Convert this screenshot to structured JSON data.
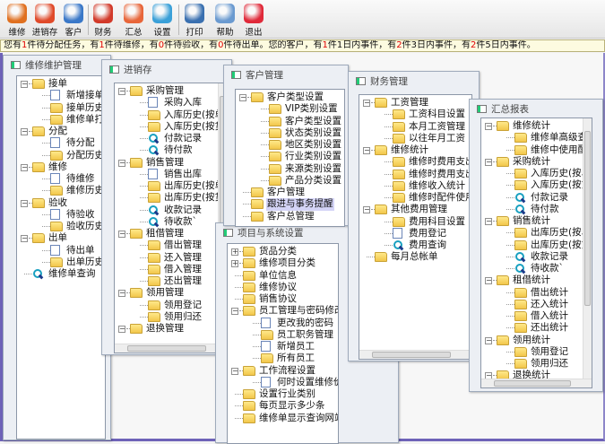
{
  "toolbar": {
    "buttons": [
      {
        "label": "维修",
        "icon": "wrench-icon",
        "color": "#e07020"
      },
      {
        "label": "进销存",
        "icon": "inventory-icon",
        "color": "#e04a2a"
      },
      {
        "label": "客户",
        "icon": "customers-icon",
        "color": "#3a78c8"
      },
      {
        "label": "财务",
        "icon": "finance-icon",
        "color": "#d23a2a"
      },
      {
        "label": "汇总",
        "icon": "summary-icon",
        "color": "#e8663a"
      },
      {
        "label": "设置",
        "icon": "settings-icon",
        "color": "#3aa0d8"
      },
      {
        "label": "打印",
        "icon": "printer-icon",
        "color": "#3a70b0"
      },
      {
        "label": "帮助",
        "icon": "help-icon",
        "color": "#6a9ad0"
      },
      {
        "label": "退出",
        "icon": "power-icon",
        "color": "#e02a3a"
      }
    ]
  },
  "status": {
    "segments": [
      {
        "text": "您有",
        "red": false
      },
      {
        "text": "1",
        "red": true
      },
      {
        "text": "件待分配任务，有",
        "red": false
      },
      {
        "text": "1",
        "red": true
      },
      {
        "text": "件待维修，有",
        "red": false
      },
      {
        "text": "0",
        "red": true
      },
      {
        "text": "件待验收，有",
        "red": false
      },
      {
        "text": "0",
        "red": true
      },
      {
        "text": "件待出单。您的客户，有",
        "red": false
      },
      {
        "text": "1",
        "red": true
      },
      {
        "text": "件1日内事件，有",
        "red": false
      },
      {
        "text": "2",
        "red": true
      },
      {
        "text": "件3日内事件，有",
        "red": false
      },
      {
        "text": "2",
        "red": true
      },
      {
        "text": "件5日内事件。",
        "red": false
      }
    ]
  },
  "windows": [
    {
      "id": "w1",
      "title": "维修维护管理",
      "items": [
        {
          "label": "接单",
          "level": 0,
          "icon": "folder",
          "exp": "-"
        },
        {
          "label": "新增接单登记",
          "level": 1,
          "icon": "page"
        },
        {
          "label": "接单历史",
          "level": 1,
          "icon": "folder"
        },
        {
          "label": "维修单打印设",
          "level": 1,
          "icon": "folder"
        },
        {
          "label": "分配",
          "level": 0,
          "icon": "folder",
          "exp": "-"
        },
        {
          "label": "待分配",
          "level": 1,
          "icon": "page"
        },
        {
          "label": "分配历史",
          "level": 1,
          "icon": "folder"
        },
        {
          "label": "维修",
          "level": 0,
          "icon": "folder",
          "exp": "-"
        },
        {
          "label": "待维修",
          "level": 1,
          "icon": "page"
        },
        {
          "label": "维修历史",
          "level": 1,
          "icon": "folder"
        },
        {
          "label": "验收",
          "level": 0,
          "icon": "folder",
          "exp": "-"
        },
        {
          "label": "待验收",
          "level": 1,
          "icon": "page"
        },
        {
          "label": "验收历史",
          "level": 1,
          "icon": "folder"
        },
        {
          "label": "出单",
          "level": 0,
          "icon": "folder",
          "exp": "-"
        },
        {
          "label": "待出单",
          "level": 1,
          "icon": "page"
        },
        {
          "label": "出单历史",
          "level": 1,
          "icon": "folder"
        },
        {
          "label": "维修单查询",
          "level": 0,
          "icon": "search"
        }
      ]
    },
    {
      "id": "w2",
      "title": "进销存",
      "items": [
        {
          "label": "采购管理",
          "level": 0,
          "icon": "folder",
          "exp": "-"
        },
        {
          "label": "采购入库",
          "level": 1,
          "icon": "page"
        },
        {
          "label": "入库历史(按单据",
          "level": 1,
          "icon": "folder"
        },
        {
          "label": "入库历史(按货品",
          "level": 1,
          "icon": "folder"
        },
        {
          "label": "付款记录",
          "level": 1,
          "icon": "search"
        },
        {
          "label": "待付款",
          "level": 1,
          "icon": "search"
        },
        {
          "label": "销售管理",
          "level": 0,
          "icon": "folder",
          "exp": "-"
        },
        {
          "label": "销售出库",
          "level": 1,
          "icon": "page"
        },
        {
          "label": "出库历史(按单据",
          "level": 1,
          "icon": "folder"
        },
        {
          "label": "出库历史(按货品",
          "level": 1,
          "icon": "folder"
        },
        {
          "label": "收款记录",
          "level": 1,
          "icon": "search"
        },
        {
          "label": "待收款`",
          "level": 1,
          "icon": "search"
        },
        {
          "label": "租借管理",
          "level": 0,
          "icon": "folder",
          "exp": "-"
        },
        {
          "label": "借出管理",
          "level": 1,
          "icon": "folder"
        },
        {
          "label": "还入管理",
          "level": 1,
          "icon": "folder"
        },
        {
          "label": "借入管理",
          "level": 1,
          "icon": "folder"
        },
        {
          "label": "还出管理",
          "level": 1,
          "icon": "folder"
        },
        {
          "label": "领用管理",
          "level": 0,
          "icon": "folder",
          "exp": "-"
        },
        {
          "label": "领用登记",
          "level": 1,
          "icon": "folder"
        },
        {
          "label": "领用归还",
          "level": 1,
          "icon": "folder"
        },
        {
          "label": "退换管理",
          "level": 0,
          "icon": "folder",
          "exp": "-"
        }
      ]
    },
    {
      "id": "w5",
      "title": "项目与系统设置",
      "items": [
        {
          "label": "货品分类",
          "level": 0,
          "icon": "folder",
          "exp": "+"
        },
        {
          "label": "维修项目分类",
          "level": 0,
          "icon": "folder",
          "exp": "+"
        },
        {
          "label": "单位信息",
          "level": 0,
          "icon": "folder"
        },
        {
          "label": "维修协议",
          "level": 0,
          "icon": "folder"
        },
        {
          "label": "销售协议",
          "level": 0,
          "icon": "folder"
        },
        {
          "label": "员工管理与密码修改",
          "level": 0,
          "icon": "folder",
          "exp": "-"
        },
        {
          "label": "更改我的密码",
          "level": 1,
          "icon": "page"
        },
        {
          "label": "员工职务管理",
          "level": 1,
          "icon": "folder"
        },
        {
          "label": "新增员工",
          "level": 1,
          "icon": "page"
        },
        {
          "label": "所有员工",
          "level": 1,
          "icon": "folder"
        },
        {
          "label": "工作流程设置",
          "level": 0,
          "icon": "folder",
          "exp": "-"
        },
        {
          "label": "何时设置维修价格",
          "level": 1,
          "icon": "page"
        },
        {
          "label": "设置行业类别",
          "level": 0,
          "icon": "folder"
        },
        {
          "label": "每页显示多少条",
          "level": 0,
          "icon": "folder"
        },
        {
          "label": "维修单显示查询网站",
          "level": 0,
          "icon": "folder"
        }
      ]
    },
    {
      "id": "w3",
      "title": "客户管理",
      "items": [
        {
          "label": "客户类型设置",
          "level": 0,
          "icon": "folder",
          "exp": "-"
        },
        {
          "label": "VIP类别设置",
          "level": 1,
          "icon": "folder"
        },
        {
          "label": "客户类型设置",
          "level": 1,
          "icon": "folder"
        },
        {
          "label": "状态类别设置",
          "level": 1,
          "icon": "folder"
        },
        {
          "label": "地区类别设置",
          "level": 1,
          "icon": "folder"
        },
        {
          "label": "行业类别设置",
          "level": 1,
          "icon": "folder"
        },
        {
          "label": "来源类别设置",
          "level": 1,
          "icon": "folder"
        },
        {
          "label": "产品分类设置",
          "level": 1,
          "icon": "folder"
        },
        {
          "label": "客户管理",
          "level": 0,
          "icon": "folder"
        },
        {
          "label": "跟进与事务提醒",
          "level": 0,
          "icon": "folder",
          "selected": true
        },
        {
          "label": "客户总管理",
          "level": 0,
          "icon": "folder"
        }
      ]
    },
    {
      "id": "w4",
      "title": "财务管理",
      "items": [
        {
          "label": "工资管理",
          "level": 0,
          "icon": "folder",
          "exp": "-"
        },
        {
          "label": "工资科目设置",
          "level": 1,
          "icon": "folder"
        },
        {
          "label": "本月工资管理",
          "level": 1,
          "icon": "folder"
        },
        {
          "label": "以往年月工资",
          "level": 1,
          "icon": "folder"
        },
        {
          "label": "维修统计",
          "level": 0,
          "icon": "folder",
          "exp": "-"
        },
        {
          "label": "维修时费用支出科目",
          "level": 1,
          "icon": "folder"
        },
        {
          "label": "维修时费用支出统计",
          "level": 1,
          "icon": "folder"
        },
        {
          "label": "维修收入统计",
          "level": 1,
          "icon": "folder"
        },
        {
          "label": "维修时配件使用统计",
          "level": 1,
          "icon": "folder"
        },
        {
          "label": "其他费用管理",
          "level": 0,
          "icon": "folder",
          "exp": "-"
        },
        {
          "label": "费用科目设置",
          "level": 1,
          "icon": "folder"
        },
        {
          "label": "费用登记",
          "level": 1,
          "icon": "page"
        },
        {
          "label": "费用查询",
          "level": 1,
          "icon": "search"
        },
        {
          "label": "每月总帐单",
          "level": 0,
          "icon": "folder"
        }
      ]
    },
    {
      "id": "w6",
      "title": "汇总报表",
      "items": [
        {
          "label": "维修统计",
          "level": 0,
          "icon": "folder",
          "exp": "-"
        },
        {
          "label": "维修单高级查询",
          "level": 1,
          "icon": "folder"
        },
        {
          "label": "维修中使用配件",
          "level": 1,
          "icon": "folder"
        },
        {
          "label": "采购统计",
          "level": 0,
          "icon": "folder",
          "exp": "-"
        },
        {
          "label": "入库历史(按单据",
          "level": 1,
          "icon": "folder"
        },
        {
          "label": "入库历史(按货品",
          "level": 1,
          "icon": "folder"
        },
        {
          "label": "付款记录",
          "level": 1,
          "icon": "search"
        },
        {
          "label": "待付款",
          "level": 1,
          "icon": "search"
        },
        {
          "label": "销售统计",
          "level": 0,
          "icon": "folder",
          "exp": "-"
        },
        {
          "label": "出库历史(按单据",
          "level": 1,
          "icon": "folder"
        },
        {
          "label": "出库历史(按货品",
          "level": 1,
          "icon": "folder"
        },
        {
          "label": "收款记录",
          "level": 1,
          "icon": "search"
        },
        {
          "label": "待收款`",
          "level": 1,
          "icon": "search"
        },
        {
          "label": "租借统计",
          "level": 0,
          "icon": "folder",
          "exp": "-"
        },
        {
          "label": "借出统计",
          "level": 1,
          "icon": "folder"
        },
        {
          "label": "还入统计",
          "level": 1,
          "icon": "folder"
        },
        {
          "label": "借入统计",
          "level": 1,
          "icon": "folder"
        },
        {
          "label": "还出统计",
          "level": 1,
          "icon": "folder"
        },
        {
          "label": "领用统计",
          "level": 0,
          "icon": "folder",
          "exp": "-"
        },
        {
          "label": "领用登记",
          "level": 1,
          "icon": "folder"
        },
        {
          "label": "领用归还",
          "level": 1,
          "icon": "folder"
        },
        {
          "label": "退换统计",
          "level": 0,
          "icon": "folder",
          "exp": "-"
        }
      ]
    }
  ]
}
